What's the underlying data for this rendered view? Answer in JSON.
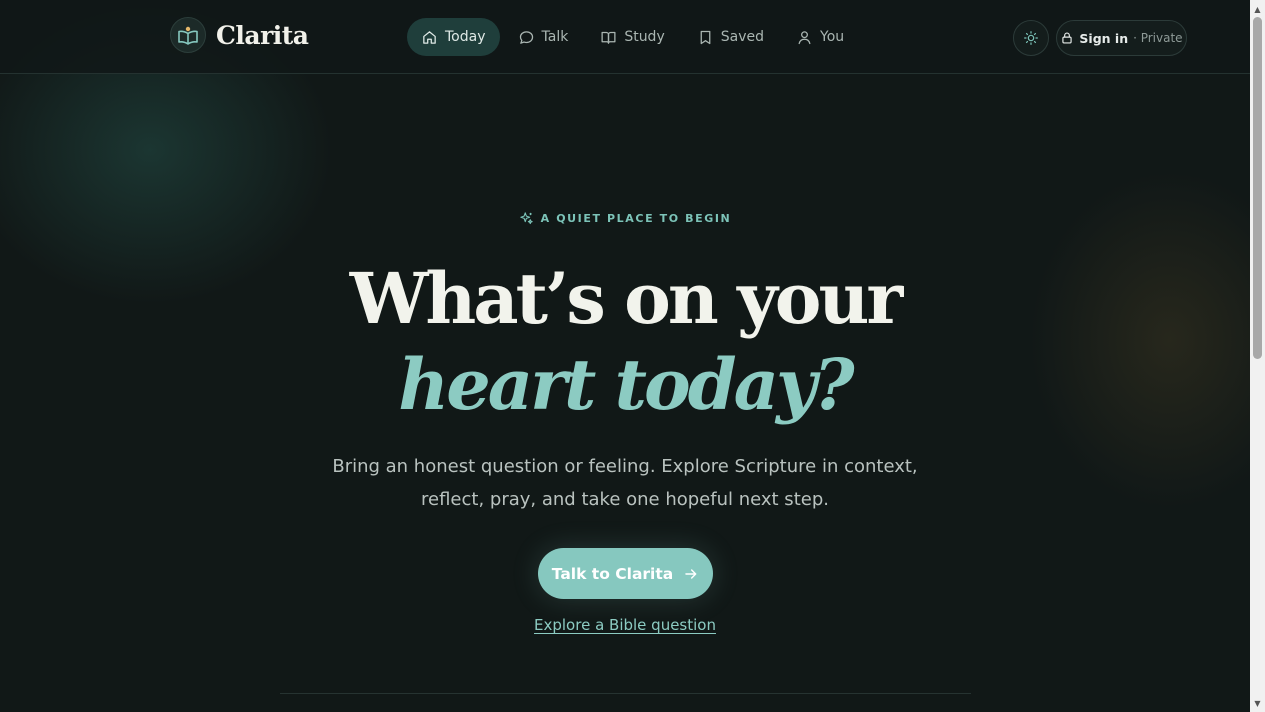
{
  "brand": {
    "name": "Clarita",
    "accent": "#86c8bf",
    "background": "#111817"
  },
  "nav": {
    "items": [
      {
        "label": "Today",
        "icon": "home-icon",
        "active": true
      },
      {
        "label": "Talk",
        "icon": "chat-bubble-icon",
        "active": false
      },
      {
        "label": "Study",
        "icon": "open-book-icon",
        "active": false
      },
      {
        "label": "Saved",
        "icon": "bookmark-icon",
        "active": false
      },
      {
        "label": "You",
        "icon": "user-icon",
        "active": false
      }
    ]
  },
  "header": {
    "theme_toggle_icon": "sun-icon",
    "signin_label": "Sign in",
    "signin_sub": "· Private"
  },
  "hero": {
    "eyebrow": "A QUIET PLACE TO BEGIN",
    "headline_line1": "What’s on your",
    "headline_line2": "heart today?",
    "subtitle_line1": "Bring an honest question or feeling. Explore Scripture in context,",
    "subtitle_line2": "reflect, pray, and take one hopeful next step.",
    "cta_label": "Talk to Clarita",
    "secondary_link": "Explore a Bible question"
  }
}
